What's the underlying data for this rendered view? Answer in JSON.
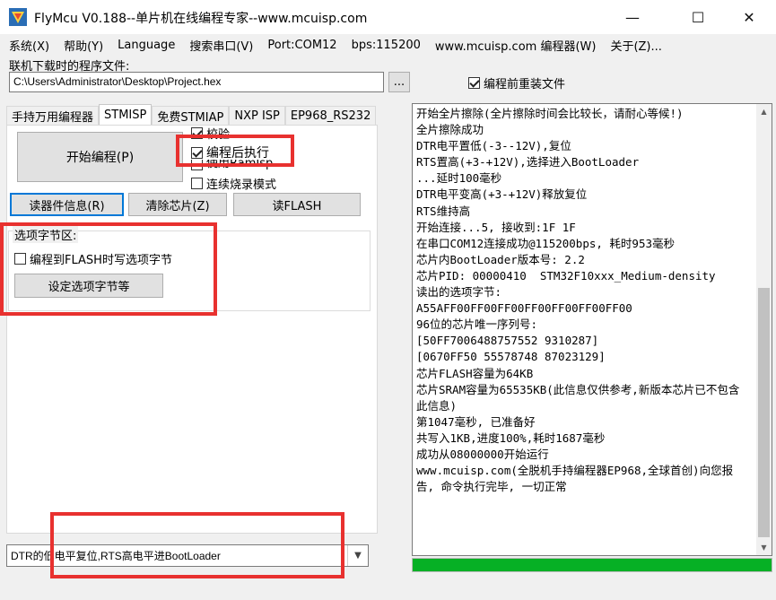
{
  "window": {
    "title": "FlyMcu V0.188--单片机在线编程专家--www.mcuisp.com",
    "minimize_glyph": "—",
    "maximize_glyph": "☐",
    "close_glyph": "✕"
  },
  "menu": [
    "系统(X)",
    "帮助(Y)",
    "Language",
    "搜索串口(V)",
    "Port:COM12",
    "bps:115200",
    "www.mcuisp.com 编程器(W)",
    "关于(Z)..."
  ],
  "file": {
    "label": "联机下载时的程序文件:",
    "path": "C:\\Users\\Administrator\\Desktop\\Project.hex",
    "browse_label": "...",
    "reload_label": "编程前重装文件",
    "reload_checked": true
  },
  "tabs": [
    "手持万用编程器",
    "STMISP",
    "免费STMIAP",
    "NXP ISP",
    "EP968_RS232"
  ],
  "active_tab": "STMISP",
  "stmisp": {
    "start_button": "开始编程(P)",
    "checkbox_verify": "校验",
    "checkbox_run_after": "编程后执行",
    "checkbox_ramisp": "使用RamIsp",
    "checkbox_continuous": "连续烧录模式",
    "read_info_button": "读器件信息(R)",
    "erase_button": "清除芯片(Z)",
    "read_flash_button": "读FLASH"
  },
  "option_bytes": {
    "title": "选项字节区:",
    "write_checkbox": "编程到FLASH时写选项字节",
    "set_button": "设定选项字节等"
  },
  "reset_mode": {
    "selected": "DTR的低电平复位,RTS高电平进BootLoader"
  },
  "log": [
    "开始全片擦除(全片擦除时间会比较长，请耐心等候!)",
    "全片擦除成功",
    "DTR电平置低(-3--12V),复位",
    "RTS置高(+3-+12V),选择进入BootLoader",
    "...延时100毫秒",
    "DTR电平变高(+3-+12V)释放复位",
    "RTS维持高",
    "开始连接...5, 接收到:1F 1F",
    "在串口COM12连接成功@115200bps, 耗时953毫秒",
    "芯片内BootLoader版本号: 2.2",
    "芯片PID: 00000410  STM32F10xxx_Medium-density",
    "读出的选项字节:",
    "A55AFF00FF00FF00FF00FF00FF00FF00",
    "96位的芯片唯一序列号:",
    "[50FF7006488757552 9310287]",
    "[0670FF50 55578748 87023129]",
    "芯片FLASH容量为64KB",
    "芯片SRAM容量为65535KB(此信息仅供参考,新版本芯片已不包含此信息)",
    "第1047毫秒, 已准备好",
    "共写入1KB,进度100%,耗时1687毫秒",
    "成功从08000000开始运行",
    "www.mcuisp.com(全脱机手持编程器EP968,全球首创)向您报告, 命令执行完毕, 一切正常"
  ],
  "progress_percent": 100,
  "colors": {
    "highlight": "#e8312f",
    "progress": "#06b025",
    "focus": "#0078d7"
  }
}
